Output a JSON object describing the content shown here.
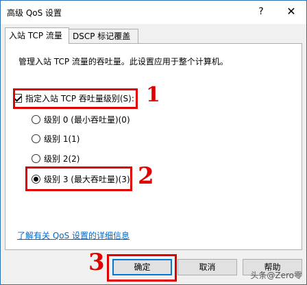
{
  "window": {
    "title": "高级 QoS 设置",
    "help_glyph": "?",
    "close_glyph": "✕"
  },
  "tabs": [
    {
      "label": "入站 TCP 流量",
      "active": true
    },
    {
      "label": "DSCP 标记覆盖",
      "active": false
    }
  ],
  "panel": {
    "description": "管理入站 TCP 流量的吞吐量。此设置应用于整个计算机。",
    "checkbox_label": "指定入站 TCP 吞吐量级别(S):",
    "checkbox_checked": true,
    "radio_options": [
      {
        "label": "级别 0 (最小吞吐量)(0)",
        "checked": false
      },
      {
        "label": "级别 1(1)",
        "checked": false
      },
      {
        "label": "级别 2(2)",
        "checked": false
      },
      {
        "label": "级别 3 (最大吞吐量)(3)",
        "checked": true
      }
    ],
    "link_text": "了解有关 QoS 设置的详细信息"
  },
  "buttons": {
    "ok": "确定",
    "cancel": "取消",
    "help": "帮助"
  },
  "annotations": {
    "marker_1": "1",
    "marker_2": "2",
    "marker_3": "3",
    "color": "#e00000"
  },
  "watermark": "头条@Zero零"
}
